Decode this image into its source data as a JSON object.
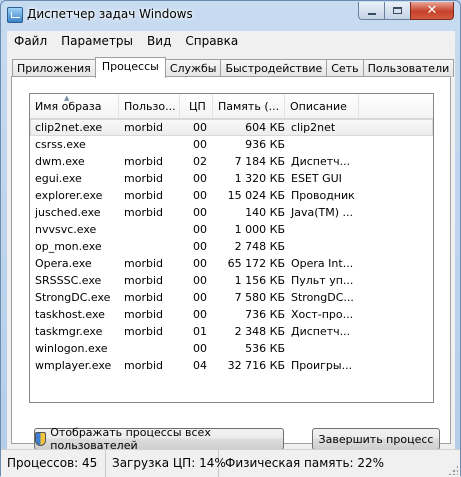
{
  "window": {
    "title": "Диспетчер задач Windows"
  },
  "menu": [
    "Файл",
    "Параметры",
    "Вид",
    "Справка"
  ],
  "tabs": [
    {
      "label": "Приложения",
      "active": false
    },
    {
      "label": "Процессы",
      "active": true
    },
    {
      "label": "Службы",
      "active": false
    },
    {
      "label": "Быстродействие",
      "active": false
    },
    {
      "label": "Сеть",
      "active": false
    },
    {
      "label": "Пользователи",
      "active": false
    }
  ],
  "table": {
    "columns": [
      "Имя образа",
      "Пользо...",
      "ЦП",
      "Память (...",
      "Описание"
    ],
    "rows": [
      {
        "name": "clip2net.exe",
        "user": "morbid",
        "cpu": "00",
        "mem": "604 КБ",
        "desc": "clip2net",
        "selected": true
      },
      {
        "name": "csrss.exe",
        "user": "",
        "cpu": "00",
        "mem": "936 КБ",
        "desc": ""
      },
      {
        "name": "dwm.exe",
        "user": "morbid",
        "cpu": "02",
        "mem": "7 184 КБ",
        "desc": "Диспетч..."
      },
      {
        "name": "egui.exe",
        "user": "morbid",
        "cpu": "00",
        "mem": "1 320 КБ",
        "desc": "ESET GUI"
      },
      {
        "name": "explorer.exe",
        "user": "morbid",
        "cpu": "00",
        "mem": "15 024 КБ",
        "desc": "Проводник"
      },
      {
        "name": "jusched.exe",
        "user": "morbid",
        "cpu": "00",
        "mem": "140 КБ",
        "desc": "Java(TM) ..."
      },
      {
        "name": "nvvsvc.exe",
        "user": "",
        "cpu": "00",
        "mem": "1 000 КБ",
        "desc": ""
      },
      {
        "name": "op_mon.exe",
        "user": "",
        "cpu": "00",
        "mem": "2 748 КБ",
        "desc": ""
      },
      {
        "name": "Opera.exe",
        "user": "morbid",
        "cpu": "00",
        "mem": "65 172 КБ",
        "desc": "Opera Int..."
      },
      {
        "name": "SRSSSC.exe",
        "user": "morbid",
        "cpu": "00",
        "mem": "1 156 КБ",
        "desc": "Пульт уп..."
      },
      {
        "name": "StrongDC.exe",
        "user": "morbid",
        "cpu": "00",
        "mem": "7 580 КБ",
        "desc": "StrongDC..."
      },
      {
        "name": "taskhost.exe",
        "user": "morbid",
        "cpu": "00",
        "mem": "736 КБ",
        "desc": "Хост-про..."
      },
      {
        "name": "taskmgr.exe",
        "user": "morbid",
        "cpu": "01",
        "mem": "2 348 КБ",
        "desc": "Диспетч..."
      },
      {
        "name": "winlogon.exe",
        "user": "",
        "cpu": "00",
        "mem": "536 КБ",
        "desc": ""
      },
      {
        "name": "wmplayer.exe",
        "user": "morbid",
        "cpu": "04",
        "mem": "32 716 КБ",
        "desc": "Проигры..."
      }
    ]
  },
  "buttons": {
    "show_all": "Отображать процессы всех пользователей",
    "end_process": "Завершить процесс"
  },
  "status": {
    "processes": "Процессов: 45",
    "cpu": "Загрузка ЦП: 14%",
    "memory": "Физическая память: 22%"
  },
  "icons": {
    "app": "taskmgr-icon",
    "shield": "uac-shield-icon",
    "sort": "sort-ascending-icon"
  }
}
